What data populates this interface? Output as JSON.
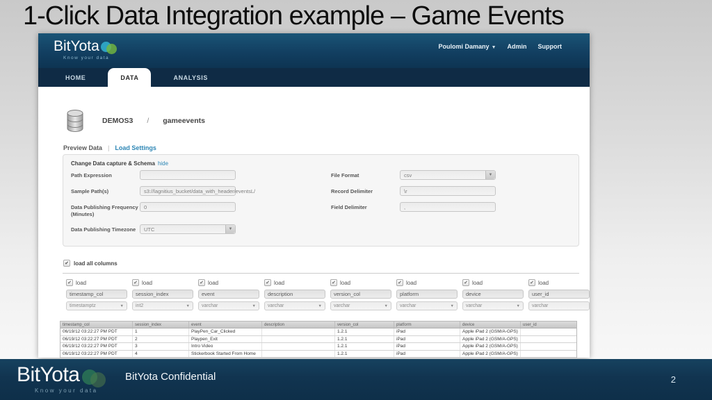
{
  "slide": {
    "title": "1-Click Data Integration example – Game Events",
    "footer_text": "BitYota Confidential",
    "page_number": "2"
  },
  "brand": {
    "name": "BitYota",
    "tagline": "Know your data"
  },
  "app": {
    "header": {
      "user_menu": "Poulomi Damany",
      "admin_label": "Admin",
      "support_label": "Support"
    },
    "tabs": [
      {
        "label": "HOME",
        "active": false
      },
      {
        "label": "DATA",
        "active": true
      },
      {
        "label": "ANALYSIS",
        "active": false
      }
    ],
    "breadcrumb": {
      "database": "DEMOS3",
      "separator": "/",
      "table": "gameevents"
    },
    "subnav": {
      "preview_label": "Preview Data",
      "separator": "|",
      "load_settings_label": "Load Settings"
    },
    "form": {
      "section_title": "Change Data capture & Schema",
      "hide_link": "hide",
      "fields_left": [
        {
          "label": "Path Expression",
          "value": "",
          "type": "input"
        },
        {
          "label": "Sample Path(s)",
          "value": "s3://lagnitius_bucket/data_with_header/eventsL/",
          "type": "input"
        },
        {
          "label": "Data Publishing Frequency (Minutes)",
          "value": "0",
          "type": "input"
        },
        {
          "label": "Data Publishing Timezone",
          "value": "UTC",
          "type": "select"
        }
      ],
      "fields_right": [
        {
          "label": "File Format",
          "value": "csv",
          "type": "select"
        },
        {
          "label": "Record Delimiter",
          "value": "\\r",
          "type": "input"
        },
        {
          "label": "Field Delimiter",
          "value": ",",
          "type": "input"
        }
      ]
    },
    "load_all_label": "load all columns",
    "load_label": "load",
    "columns": [
      {
        "name": "timestamp_col",
        "type": "timestamptz"
      },
      {
        "name": "session_index",
        "type": "int2"
      },
      {
        "name": "event",
        "type": "varchar"
      },
      {
        "name": "description",
        "type": "varchar"
      },
      {
        "name": "version_col",
        "type": "varchar"
      },
      {
        "name": "platform",
        "type": "varchar"
      },
      {
        "name": "device",
        "type": "varchar"
      },
      {
        "name": "user_id",
        "type": "varchar"
      }
    ],
    "table": {
      "headers": [
        "timestamp_col",
        "session_index",
        "event",
        "description",
        "version_col",
        "platform",
        "device",
        "user_id"
      ],
      "rows": [
        [
          "06/19/12 03:22:27 PM PDT",
          "1",
          "PlayPen_Car_Clicked",
          "",
          "1.2.1",
          "iPad",
          "Apple iPad 2 (GSM/A-GPS)",
          ""
        ],
        [
          "06/19/12 03:22:27 PM PDT",
          "2",
          "Playpen_Exit",
          "",
          "1.2.1",
          "iPad",
          "Apple iPad 2 (GSM/A-GPS)",
          ""
        ],
        [
          "06/19/12 03:22:27 PM PDT",
          "3",
          "Intro Video",
          "",
          "1.2.1",
          "iPad",
          "Apple iPad 2 (GSM/A-GPS)",
          ""
        ],
        [
          "06/19/12 03:22:27 PM PDT",
          "4",
          "Stickerbook Started From Home",
          "",
          "1.2.1",
          "iPad",
          "Apple iPad 2 (GSM/A-GPS)",
          ""
        ]
      ]
    }
  }
}
